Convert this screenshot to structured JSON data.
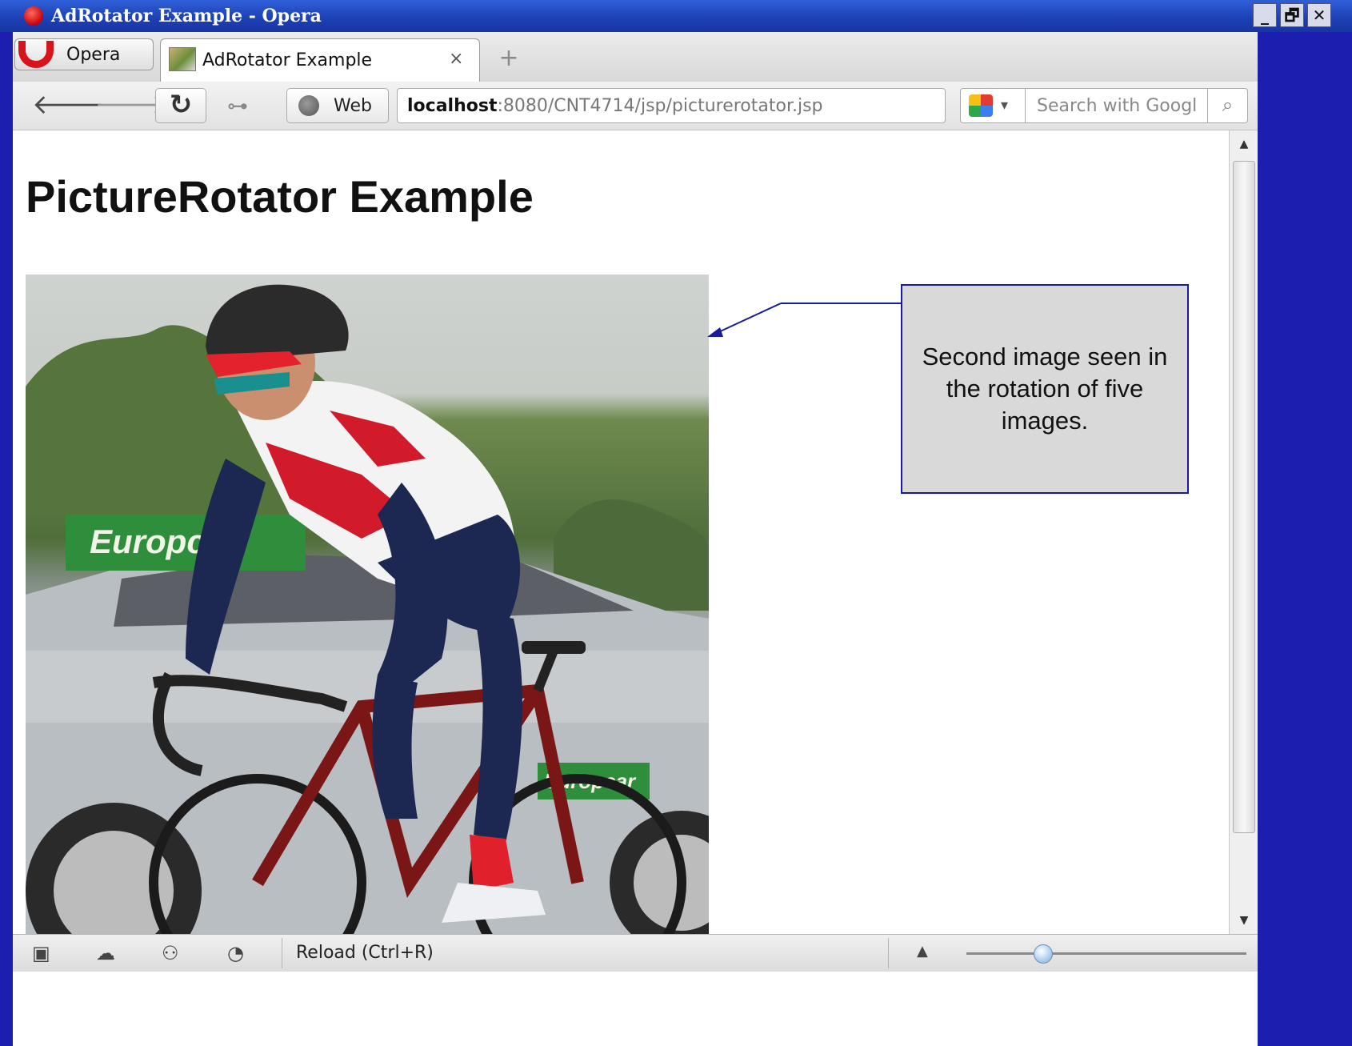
{
  "window": {
    "title": "AdRotator Example - Opera",
    "minimize_label": "_",
    "restore_label": "🗗",
    "close_label": "✕"
  },
  "tabbar": {
    "opera_menu_label": "Opera",
    "active_tab_label": "AdRotator Example",
    "tab_close_glyph": "×",
    "new_tab_glyph": "+",
    "tab_menu_glyph": "⨯"
  },
  "addressbar": {
    "back_glyph": "🡐",
    "forward_glyph": "🡒",
    "reload_glyph": "↻",
    "key_glyph": "⊶",
    "web_label": "Web",
    "url_host": "localhost",
    "url_rest": ":8080/CNT4714/jsp/picturerotator.jsp",
    "search_placeholder": "Search with Googl",
    "search_glyph": "⌕",
    "engine_caret": "▾"
  },
  "page": {
    "title": "PictureRotator Example",
    "image_alt": "Cyclist riding a road bike in front of a silver Europcar car"
  },
  "annotation": {
    "text": "Second image seen in the rotation of five images."
  },
  "statusbar": {
    "panel_icon": "▣",
    "cloud_icon": "☁",
    "share_icon": "⚇",
    "speed_icon": "◔",
    "status_text": "Reload (Ctrl+R)",
    "zoom_caret": "▲",
    "zoom_level": 0.27
  },
  "colors": {
    "titlebar": "#1c3fb5",
    "desktop_border": "#1a1fb0",
    "callout_border": "#1a1aa0",
    "callout_fill": "#d9d9d9"
  }
}
